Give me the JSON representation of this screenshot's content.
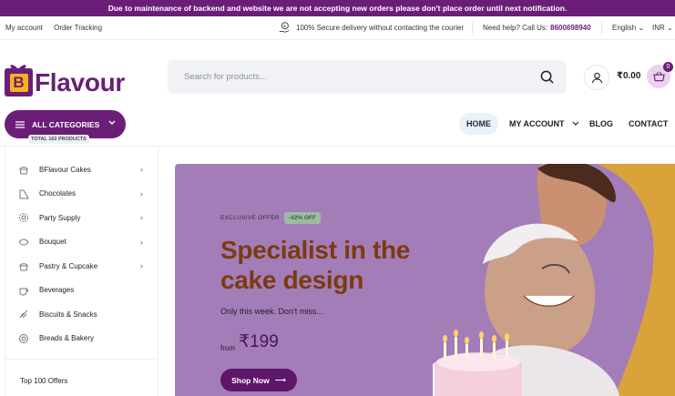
{
  "notice": "Due to maintenance of backend and website we are not accepting new orders please don't place order until next notification.",
  "topbar": {
    "links": [
      "My account",
      "Order Tracking"
    ],
    "secure_text": "100% Secure delivery without contacting the courier",
    "help_text": "Need help? Call Us:",
    "phone": "8600698940",
    "language": "English",
    "currency": "INR"
  },
  "logo": {
    "letter": "B",
    "text": "Flavour"
  },
  "search": {
    "placeholder": "Search for products..."
  },
  "header": {
    "cart_total": "₹0.00",
    "cart_count": "0"
  },
  "nav": {
    "all_categories": "ALL CATEGORIES",
    "total_products": "TOTAL 162 PRODUCTS",
    "menu": [
      "HOME",
      "MY ACCOUNT",
      "BLOG",
      "CONTACT"
    ]
  },
  "sidebar": {
    "categories": [
      {
        "label": "BFlavour Cakes",
        "icon": "cupcake-icon",
        "has_arrow": true
      },
      {
        "label": "Chocolates",
        "icon": "chocolate-icon",
        "has_arrow": true
      },
      {
        "label": "Party Supply",
        "icon": "gear-icon",
        "has_arrow": true
      },
      {
        "label": "Bouquet",
        "icon": "flower-icon",
        "has_arrow": true
      },
      {
        "label": "Pastry & Cupcake",
        "icon": "cupcake-icon",
        "has_arrow": true
      },
      {
        "label": "Beverages",
        "icon": "cup-icon",
        "has_arrow": false
      },
      {
        "label": "Biscuits & Snacks",
        "icon": "biscuit-icon",
        "has_arrow": false
      },
      {
        "label": "Breads & Bakery",
        "icon": "bread-icon",
        "has_arrow": false
      }
    ],
    "offers": "Top 100 Offers"
  },
  "banner": {
    "exclusive": "EXCLUSIVE OFFER",
    "discount": "-42% OFF",
    "headline": "Specialist in the cake design",
    "subtitle": "Only this week. Don't miss...",
    "from_label": "from",
    "price": "₹199",
    "cta": "Shop Now"
  },
  "colors": {
    "brand": "#6b1e78",
    "banner_bg": "#a37db8",
    "headline": "#7b3b0f",
    "logo_accent": "#f6b21a"
  }
}
